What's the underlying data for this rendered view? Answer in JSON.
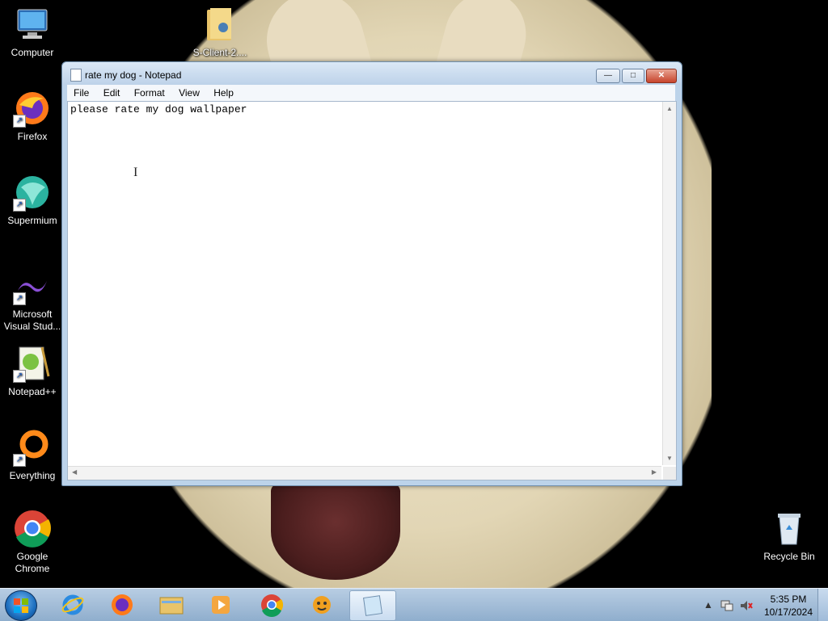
{
  "desktop": {
    "icons": [
      {
        "label": "Computer",
        "icon": "computer-icon"
      },
      {
        "label": "S-Client-2....",
        "icon": "folder-icon"
      },
      {
        "label": "Firefox",
        "icon": "firefox-icon"
      },
      {
        "label": "Supermium",
        "icon": "supermium-icon"
      },
      {
        "label": "Microsoft Visual Stud...",
        "icon": "visual-studio-icon"
      },
      {
        "label": "Notepad++",
        "icon": "notepadpp-icon"
      },
      {
        "label": "Everything",
        "icon": "everything-icon"
      },
      {
        "label": "Google Chrome",
        "icon": "chrome-icon"
      },
      {
        "label": "Recycle Bin",
        "icon": "recycle-bin-icon"
      }
    ]
  },
  "window": {
    "title": "rate my dog - Notepad",
    "controls": {
      "minimize": "—",
      "maximize": "□",
      "close": "✕"
    },
    "menu": [
      "File",
      "Edit",
      "Format",
      "View",
      "Help"
    ],
    "content": "please rate my dog wallpaper"
  },
  "taskbar": {
    "items": [
      "internet-explorer-icon",
      "firefox-icon",
      "file-explorer-icon",
      "media-player-icon",
      "chrome-icon",
      "app-icon",
      "notepad-icon"
    ],
    "clock": {
      "time": "5:35 PM",
      "date": "10/17/2024"
    }
  },
  "colors": {
    "accent": "#1d6fbf",
    "close": "#c7442c"
  }
}
